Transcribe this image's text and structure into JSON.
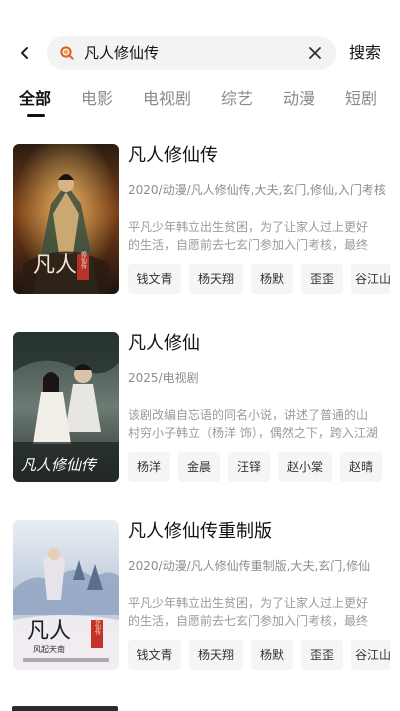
{
  "search": {
    "back_icon": "chevron-left-icon",
    "query": "凡人修仙传",
    "search_icon": "search-icon",
    "clear_icon": "close-icon",
    "button_label": "搜索"
  },
  "tabs": [
    {
      "label": "全部",
      "active": true
    },
    {
      "label": "电影",
      "active": false
    },
    {
      "label": "电视剧",
      "active": false
    },
    {
      "label": "综艺",
      "active": false
    },
    {
      "label": "动漫",
      "active": false
    },
    {
      "label": "短剧",
      "active": false
    }
  ],
  "results": [
    {
      "title": "凡人修仙传",
      "meta": "2020/动漫/凡人修仙传,大夫,玄门,修仙,入门考核",
      "desc_line1": "平凡少年韩立出生贫困，为了让家人过上更好",
      "desc_line2": "的生活，自愿前去七玄门参加入门考核，最终",
      "cast": [
        "钱文青",
        "杨天翔",
        "杨默",
        "歪歪",
        "谷江山"
      ],
      "poster_text": "凡人",
      "poster_seal": "修仙传"
    },
    {
      "title": "凡人修仙",
      "meta": "2025/电视剧",
      "desc_line1": "该剧改编自忘语的同名小说，讲述了普通的山",
      "desc_line2": "村穷小子韩立（杨洋 饰），偶然之下，跨入江湖",
      "cast": [
        "杨洋",
        "金晨",
        "汪铎",
        "赵小棠",
        "赵晴"
      ],
      "poster_text": "凡人修仙传"
    },
    {
      "title": "凡人修仙传重制版",
      "meta": "2020/动漫/凡人修仙传重制版,大夫,玄门,修仙",
      "desc_line1": "平凡少年韩立出生贫困，为了让家人过上更好",
      "desc_line2": "的生活，自愿前去七玄门参加入门考核，最终",
      "cast": [
        "钱文青",
        "杨天翔",
        "杨默",
        "歪歪",
        "谷江山"
      ],
      "poster_text": "凡人",
      "poster_sub": "风起天南",
      "poster_seal": "修仙传"
    }
  ]
}
